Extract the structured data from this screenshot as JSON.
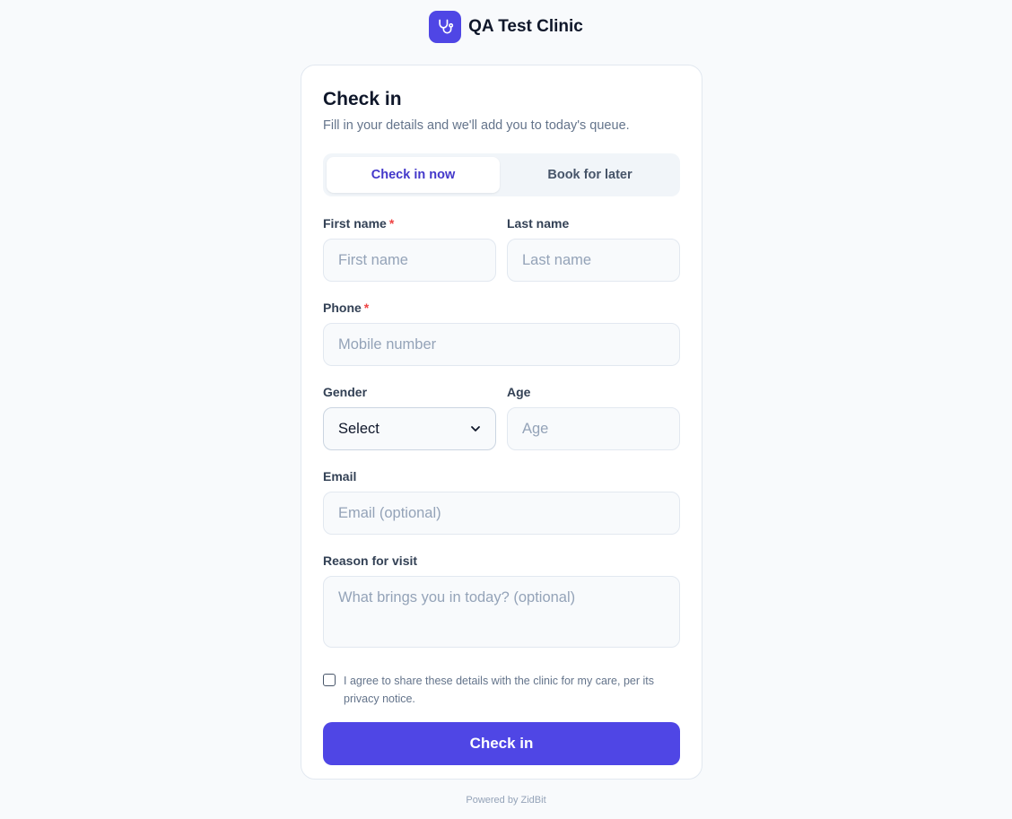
{
  "brand": {
    "name": "QA Test Clinic",
    "logo_icon": "stethoscope-icon",
    "color": "#4f46e5"
  },
  "form": {
    "title": "Check in",
    "subtitle": "Fill in your details and we'll add you to today's queue.",
    "tabs": [
      {
        "label": "Check in now",
        "active": true
      },
      {
        "label": "Book for later",
        "active": false
      }
    ],
    "fields": {
      "first_name": {
        "label": "First name",
        "required": "*",
        "placeholder": "First name"
      },
      "last_name": {
        "label": "Last name",
        "placeholder": "Last name"
      },
      "phone": {
        "label": "Phone",
        "required": "*",
        "placeholder": "Mobile number"
      },
      "gender": {
        "label": "Gender",
        "selected": "Select"
      },
      "age": {
        "label": "Age",
        "placeholder": "Age"
      },
      "email": {
        "label": "Email",
        "placeholder": "Email (optional)"
      },
      "reason": {
        "label": "Reason for visit",
        "placeholder": "What brings you in today? (optional)"
      }
    },
    "consent_text": "I agree to share these details with the clinic for my care, per its privacy notice.",
    "submit_label": "Check in"
  },
  "footer": {
    "text": "Powered by ZidBit"
  }
}
